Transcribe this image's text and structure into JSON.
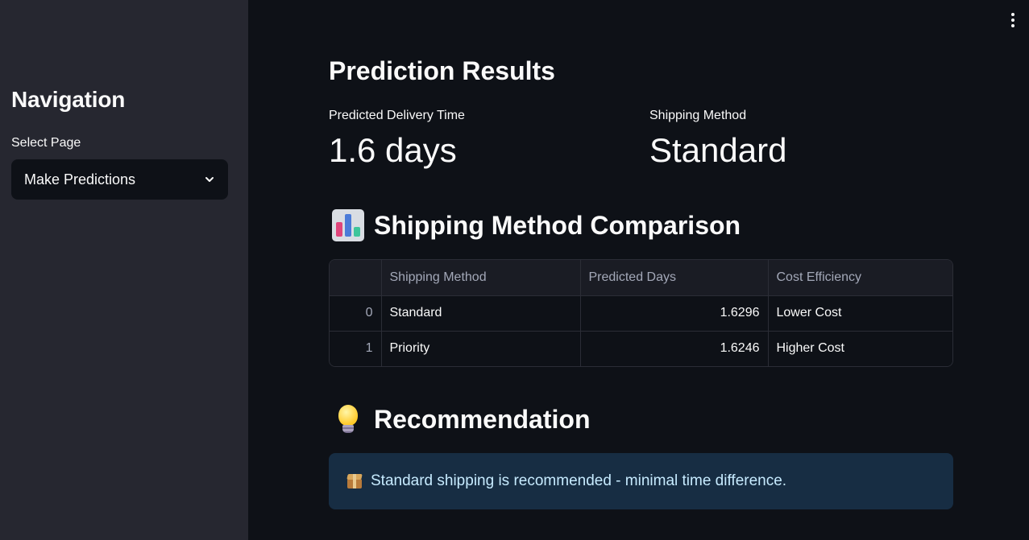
{
  "sidebar": {
    "title": "Navigation",
    "select_label": "Select Page",
    "selected_page": "Make Predictions"
  },
  "main": {
    "results_title": "Prediction Results",
    "metrics": [
      {
        "label": "Predicted Delivery Time",
        "value": "1.6 days"
      },
      {
        "label": "Shipping Method",
        "value": "Standard"
      }
    ],
    "comparison_title": "Shipping Method Comparison",
    "comparison_icon": "bar-chart-emoji",
    "table": {
      "columns": [
        "",
        "Shipping Method",
        "Predicted Days",
        "Cost Efficiency"
      ],
      "rows": [
        {
          "index": "0",
          "method": "Standard",
          "days": "1.6296",
          "cost": "Lower Cost"
        },
        {
          "index": "1",
          "method": "Priority",
          "days": "1.6246",
          "cost": "Higher Cost"
        }
      ]
    },
    "recommendation_title": "Recommendation",
    "recommendation_icon": "light-bulb-emoji",
    "recommendation_text": "Standard shipping is recommended - minimal time difference.",
    "recommendation_text_icon": "package-emoji"
  },
  "colors": {
    "sidebar_bg": "#262730",
    "main_bg": "#0e1117",
    "info_bg": "#172d43",
    "info_text": "#c7ebff"
  }
}
